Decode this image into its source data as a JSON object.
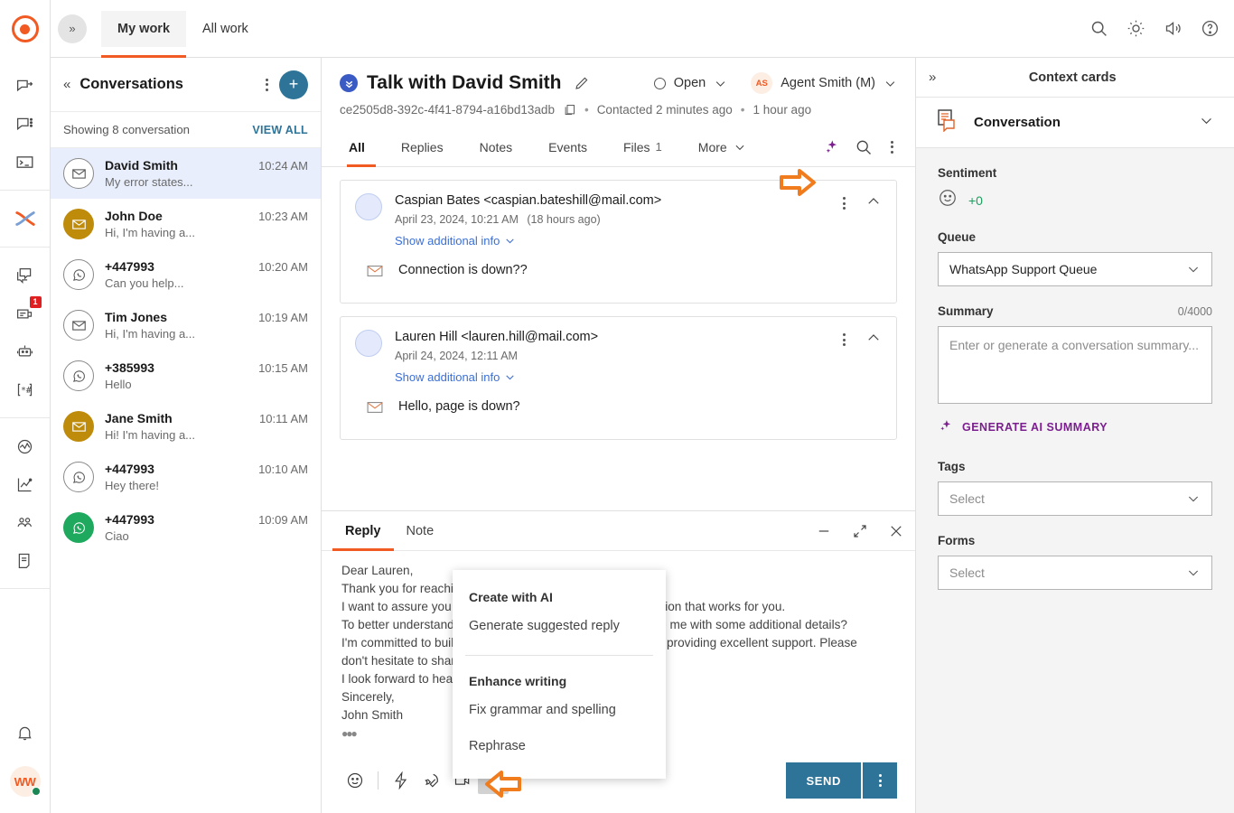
{
  "brand": {
    "accent_orange": "#f15a22",
    "accent_teal": "#2e7498",
    "ai_purple": "#7b1f8f",
    "annotation_orange": "#f07c1e"
  },
  "rail": {
    "logo_name": "app-logo",
    "items": [
      {
        "icon": "share-message-icon",
        "badge": null
      },
      {
        "icon": "chat-options-icon",
        "badge": null
      },
      {
        "icon": "terminal-icon",
        "badge": null
      },
      {
        "icon": "crossover-icon",
        "badge": null,
        "active": true
      },
      {
        "icon": "copy-chat-icon",
        "badge": null
      },
      {
        "icon": "forms-icon",
        "badge": "1"
      },
      {
        "icon": "bot-icon",
        "badge": null
      },
      {
        "icon": "snippets-icon",
        "badge": null
      },
      {
        "icon": "pulse-icon",
        "badge": null
      },
      {
        "icon": "analytics-icon",
        "badge": null
      },
      {
        "icon": "teams-icon",
        "badge": null
      },
      {
        "icon": "knowledge-icon",
        "badge": null
      },
      {
        "icon": "bell-icon",
        "badge": null
      }
    ],
    "avatar_initials": "WW"
  },
  "topbar": {
    "expand_icon": "double-chevron-right-icon",
    "tabs": [
      {
        "label": "My work",
        "active": true
      },
      {
        "label": "All work",
        "active": false
      }
    ],
    "actions": [
      {
        "icon": "search-icon"
      },
      {
        "icon": "brightness-icon"
      },
      {
        "icon": "volume-icon"
      },
      {
        "icon": "help-icon"
      }
    ]
  },
  "conversations": {
    "title": "Conversations",
    "collapse_icon": "double-chevron-left-icon",
    "more_icon": "kebab-menu-icon",
    "add_icon": "plus-icon",
    "showing_text": "Showing 8 conversation",
    "view_all": "VIEW ALL",
    "items": [
      {
        "name": "David Smith",
        "time": "10:24 AM",
        "preview": "My error states...",
        "channel": "email",
        "style": "outline",
        "selected": true
      },
      {
        "name": "John Doe",
        "time": "10:23 AM",
        "preview": "Hi, I'm having a...",
        "channel": "email",
        "style": "gold",
        "selected": false
      },
      {
        "name": "+447993",
        "time": "10:20 AM",
        "preview": "Can you help...",
        "channel": "whatsapp",
        "style": "outline",
        "selected": false
      },
      {
        "name": "Tim Jones",
        "time": "10:19 AM",
        "preview": "Hi, I'm having a...",
        "channel": "email",
        "style": "outline",
        "selected": false
      },
      {
        "name": "+385993",
        "time": "10:15 AM",
        "preview": "Hello",
        "channel": "whatsapp",
        "style": "outline",
        "selected": false
      },
      {
        "name": "Jane Smith",
        "time": "10:11 AM",
        "preview": "Hi! I'm having a...",
        "channel": "email",
        "style": "gold",
        "selected": false
      },
      {
        "name": "+447993",
        "time": "10:10 AM",
        "preview": "Hey there!",
        "channel": "whatsapp",
        "style": "outline",
        "selected": false
      },
      {
        "name": "+447993",
        "time": "10:09 AM",
        "preview": "Ciao",
        "channel": "whatsapp",
        "style": "green",
        "selected": false
      }
    ]
  },
  "conversation": {
    "title": "Talk with David Smith",
    "edit_icon": "pencil-icon",
    "status_icon": "double-chevron-down-badge-icon",
    "id": "ce2505d8-392c-4f41-8794-a16bd13adb",
    "copy_icon": "copy-icon",
    "contacted": "Contacted 2 minutes ago",
    "age": "1 hour ago",
    "separator": "•",
    "status": "Open",
    "agent": "Agent Smith (M)",
    "agent_initials": "AS",
    "tabs": [
      {
        "label": "All",
        "count": null,
        "active": true
      },
      {
        "label": "Replies",
        "count": null,
        "active": false
      },
      {
        "label": "Notes",
        "count": null,
        "active": false
      },
      {
        "label": "Events",
        "count": null,
        "active": false
      },
      {
        "label": "Files",
        "count": "1",
        "active": false
      },
      {
        "label": "More",
        "count": null,
        "active": false,
        "chevron": true
      }
    ],
    "tab_actions": [
      {
        "icon": "ai-sparkle-icon"
      },
      {
        "icon": "search-icon"
      },
      {
        "icon": "kebab-menu-icon"
      }
    ]
  },
  "messages": [
    {
      "from": "Caspian Bates <caspian.bateshill@mail.com>",
      "date": "April 23, 2024, 10:21 AM",
      "relative": "(18 hours ago)",
      "show_info": "Show additional info",
      "channel_icon": "email-icon",
      "text": "Connection is down??"
    },
    {
      "from": "Lauren Hill <lauren.hill@mail.com>",
      "date": "April 24, 2024, 12:11 AM",
      "relative": "",
      "show_info": "Show additional info",
      "channel_icon": "email-icon",
      "text": "Hello, page is down?"
    }
  ],
  "composer": {
    "tabs": [
      {
        "label": "Reply",
        "active": true
      },
      {
        "label": "Note",
        "active": false
      }
    ],
    "window_actions": [
      {
        "icon": "minimize-icon"
      },
      {
        "icon": "expand-icon"
      },
      {
        "icon": "close-icon"
      }
    ],
    "draft_lines": [
      "Dear Lauren,",
      "Thank you for reaching out to us regarding your concerns.",
      "I want to assure you that we are dedicated to finding a solution that works for you.",
      "To better understand the situation, could you please provide me with some additional details?",
      "I'm committed to building a strong relationship with you and providing excellent support. Please",
      "don't hesitate to share any further concerns you may have.",
      "I look forward to hearing from you soon.",
      "Sincerely,",
      "John Smith"
    ],
    "toolbar": [
      {
        "icon": "emoji-icon"
      },
      {
        "icon": "lightning-icon"
      },
      {
        "icon": "rocket-icon"
      },
      {
        "icon": "video-icon"
      },
      {
        "icon": "ai-sparkle-icon",
        "active": true
      }
    ],
    "send_label": "SEND",
    "send_more_icon": "kebab-menu-icon"
  },
  "ai_menu": {
    "sections": [
      {
        "title": "Create with AI",
        "items": [
          "Generate suggested reply"
        ]
      },
      {
        "title": "Enhance writing",
        "items": [
          "Fix grammar and spelling",
          "Rephrase"
        ]
      }
    ]
  },
  "context": {
    "panel_title": "Context cards",
    "collapse_icon": "double-chevron-right-icon",
    "card_title": "Conversation",
    "card_icon": "conversation-card-icon",
    "card_chevron": "chevron-down-icon",
    "sentiment_label": "Sentiment",
    "sentiment_icon": "smiley-icon",
    "sentiment_value": "+0",
    "queue_label": "Queue",
    "queue_value": "WhatsApp Support Queue",
    "summary_label": "Summary",
    "summary_count": "0/4000",
    "summary_placeholder": "Enter or generate a conversation summary...",
    "generate_ai_label": "GENERATE AI SUMMARY",
    "generate_ai_icon": "ai-sparkle-icon",
    "tags_label": "Tags",
    "tags_value": "Select",
    "forms_label": "Forms",
    "forms_value": "Select"
  },
  "annotations": [
    {
      "name": "arrow-pointing-to-ai-tab-icon",
      "direction": "right"
    },
    {
      "name": "arrow-pointing-to-ai-composer-button",
      "direction": "left"
    }
  ]
}
